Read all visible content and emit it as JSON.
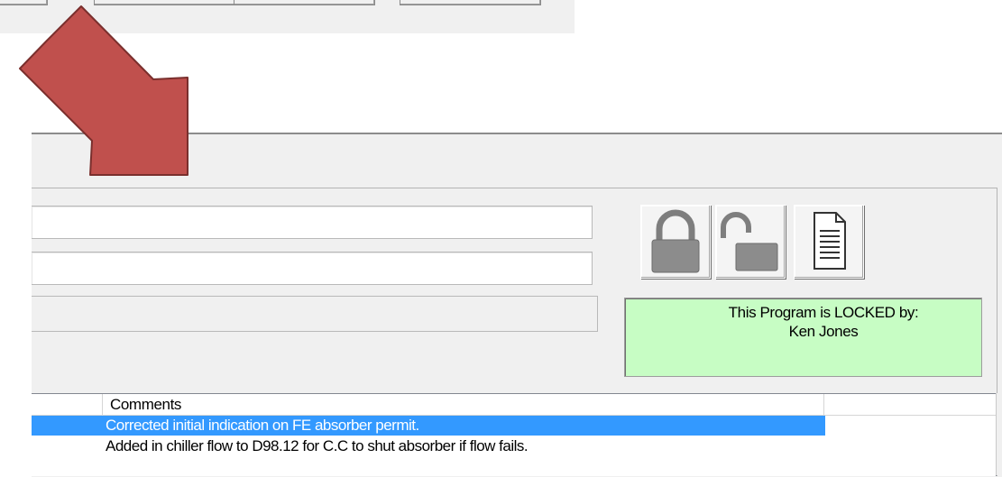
{
  "lock_panel": {
    "status_line1": "This Program is LOCKED by:",
    "status_line2": "Ken Jones",
    "status_bg": "#c7fdc4"
  },
  "toolbar_icons": {
    "lock": "lock-icon",
    "unlock": "unlock-icon",
    "document": "document-icon"
  },
  "list": {
    "columns": [
      "",
      "Comments",
      ""
    ],
    "rows": [
      {
        "comment": "Corrected initial indication on FE absorber permit.",
        "selected": true
      },
      {
        "comment": "Added in chiller flow to D98.12 for C.C to shut absorber if flow fails.",
        "selected": false
      }
    ]
  },
  "colors": {
    "selection": "#3399ff",
    "arrow": "#c0504d"
  }
}
